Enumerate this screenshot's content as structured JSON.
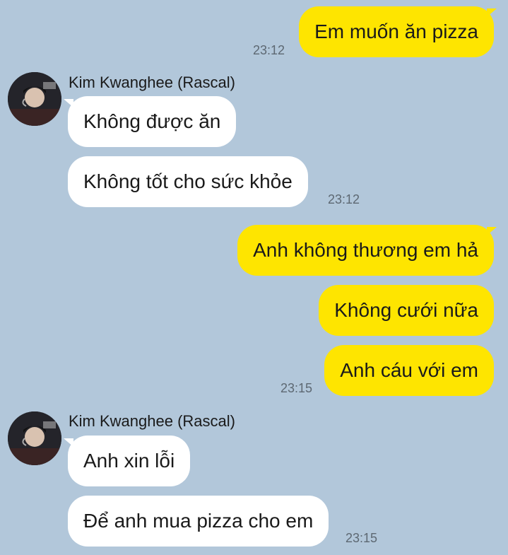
{
  "chat": {
    "messages": [
      {
        "from": "me",
        "text": "Em muốn ăn pizza",
        "time": "23:12"
      },
      {
        "from": "them",
        "text": "Không được ăn"
      },
      {
        "from": "them",
        "text": "Không tốt cho sức khỏe",
        "time": "23:12"
      },
      {
        "from": "me",
        "text": "Anh không thương em hả"
      },
      {
        "from": "me",
        "text": "Không cưới nữa"
      },
      {
        "from": "me",
        "text": "Anh cáu với em",
        "time": "23:15"
      },
      {
        "from": "them",
        "text": "Anh xin lỗi"
      },
      {
        "from": "them",
        "text": "Để anh mua pizza cho em",
        "time": "23:15"
      }
    ],
    "groups": [
      {
        "sender": "Kim Kwanghee (Rascal)"
      },
      {
        "sender": "Kim Kwanghee (Rascal)"
      }
    ]
  },
  "colors": {
    "background": "#b2c7da",
    "my_bubble": "#fee500",
    "their_bubble": "#ffffff",
    "timestamp": "#5d6872"
  },
  "icons": {
    "avatar": "profile-photo-avatar"
  }
}
